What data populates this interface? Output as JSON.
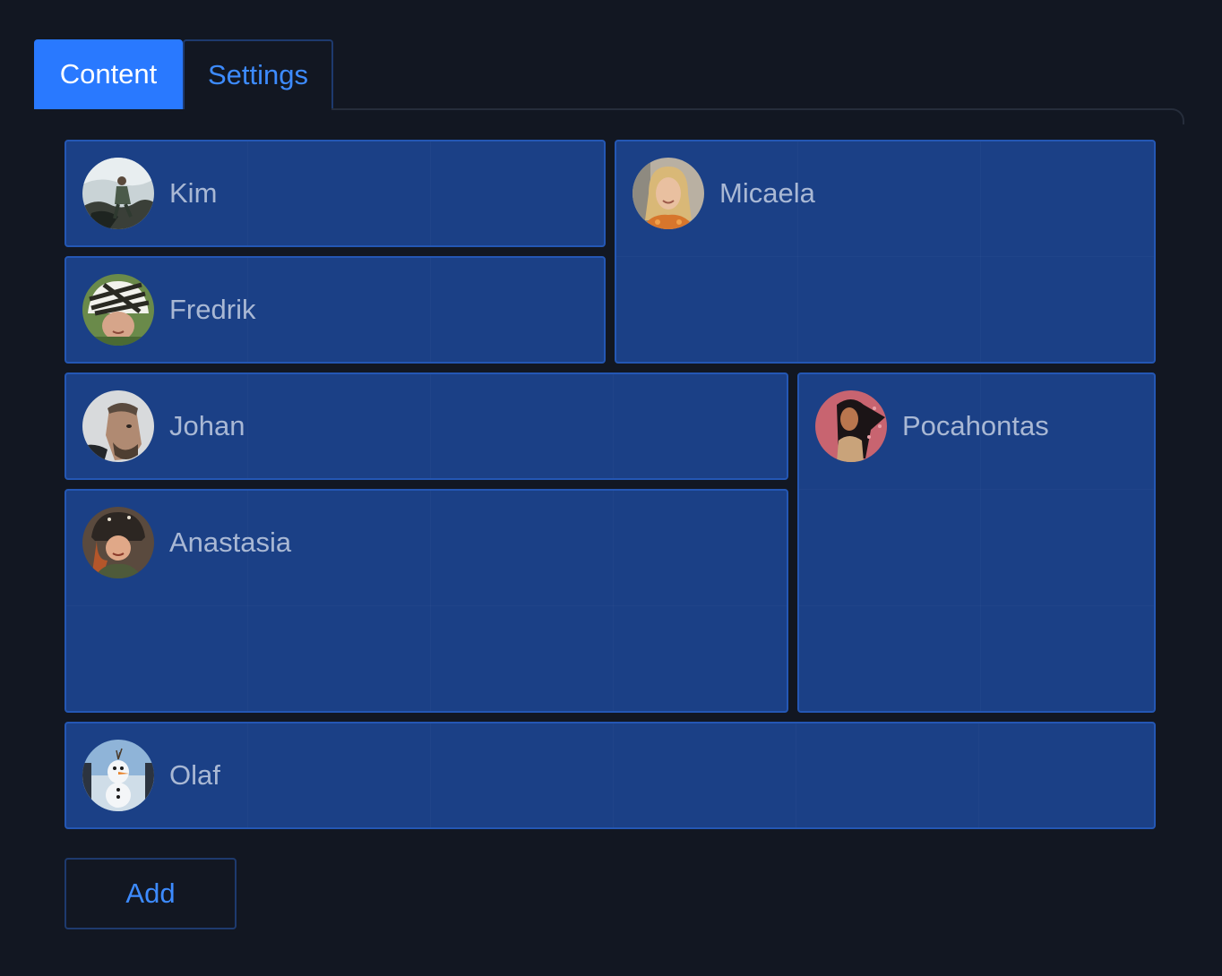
{
  "tabs": {
    "content_label": "Content",
    "settings_label": "Settings",
    "active": "content"
  },
  "grid": {
    "items": [
      {
        "name": "Kim"
      },
      {
        "name": "Micaela"
      },
      {
        "name": "Fredrik"
      },
      {
        "name": "Johan"
      },
      {
        "name": "Pocahontas"
      },
      {
        "name": "Anastasia"
      },
      {
        "name": "Olaf"
      }
    ]
  },
  "actions": {
    "add_label": "Add"
  },
  "colors": {
    "background": "#121722",
    "tab_active": "#2979ff",
    "accent_text": "#3d8bff",
    "cell_background": "#1b4086",
    "cell_border": "#2457b4",
    "cell_text": "#a9b8d4"
  }
}
